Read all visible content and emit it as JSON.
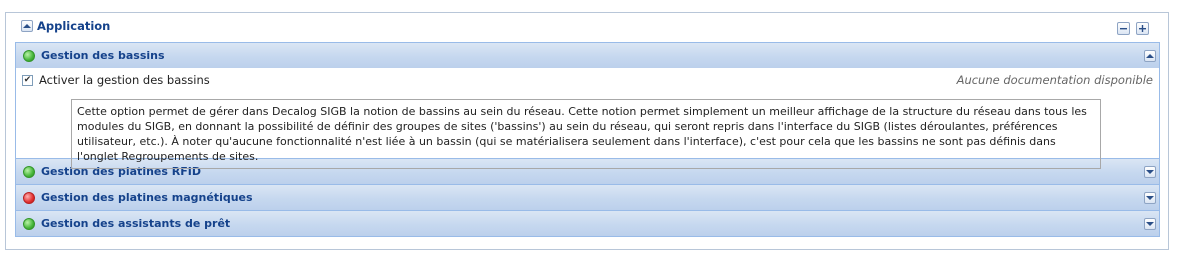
{
  "fieldset": {
    "title": "Application",
    "toggle_icon": "chevron-up-icon",
    "tools": {
      "collapse_all_icon": "minus-icon",
      "expand_all_icon": "plus-icon"
    }
  },
  "panels": [
    {
      "title": "Gestion des bassins",
      "status": "green",
      "expanded": true,
      "option_label": "Activer la gestion des bassins",
      "option_checked": true,
      "doc_note": "Aucune documentation disponible",
      "help_text": "Cette option permet de gérer dans Decalog SIGB la notion de bassins au sein du réseau. Cette notion permet simplement un meilleur affichage de la structure du réseau dans tous les modules du SIGB, en donnant la possibilité de définir des groupes de sites ('bassins') au sein du réseau, qui seront repris dans l'interface du SIGB (listes déroulantes, préférences utilisateur, etc.). À noter qu'aucune fonctionnalité n'est liée à un bassin (qui se matérialisera seulement dans l'interface), c'est pour cela que les bassins ne sont pas définis dans l'onglet Regroupements de sites."
    },
    {
      "title": "Gestion des platines RFID",
      "status": "green",
      "expanded": false
    },
    {
      "title": "Gestion des platines magnétiques",
      "status": "red",
      "expanded": false
    },
    {
      "title": "Gestion des assistants de prêt",
      "status": "green",
      "expanded": false
    }
  ],
  "colors": {
    "status_green": "#46b63a",
    "status_red": "#e2302f",
    "header_text": "#15428b",
    "panel_border": "#99bbe8"
  }
}
